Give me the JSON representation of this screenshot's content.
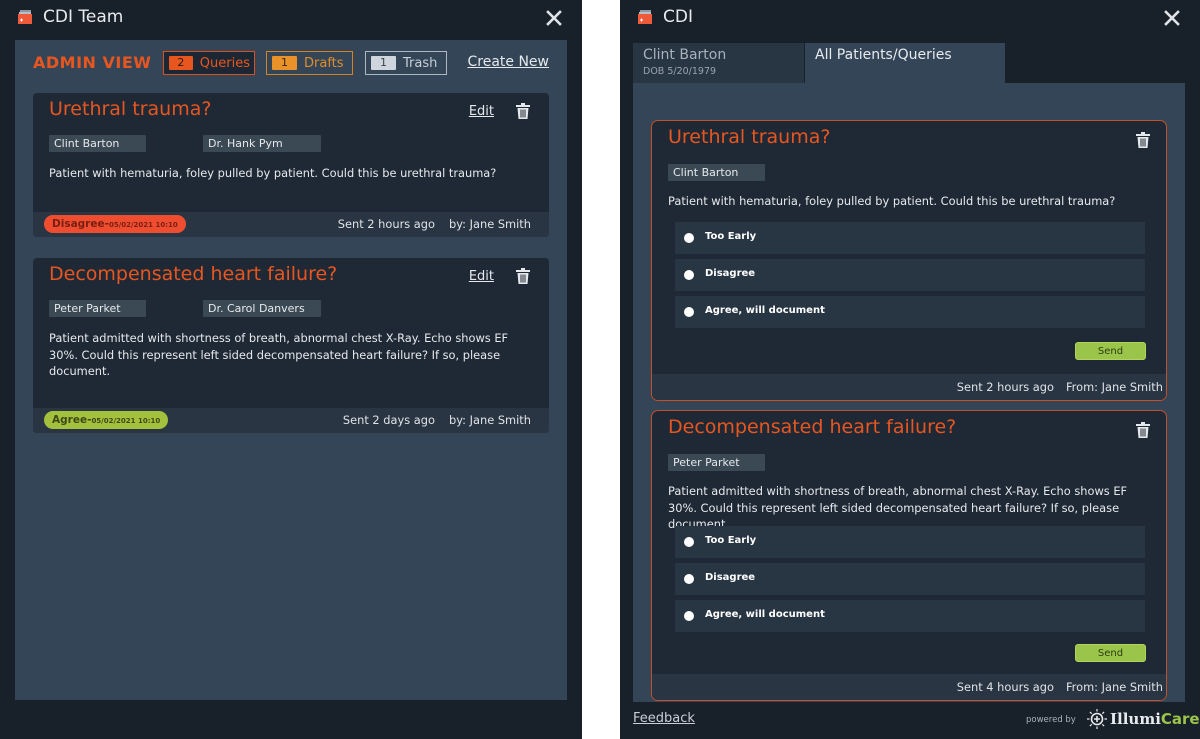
{
  "left_window": {
    "title": "CDI Team",
    "admin_title": "ADMIN VIEW",
    "filters": [
      {
        "count": "2",
        "label": "Queries",
        "color": "#e8561f"
      },
      {
        "count": "1",
        "label": "Drafts",
        "color": "#e9922a"
      },
      {
        "count": "1",
        "label": "Trash",
        "color": "#cfd5dc"
      }
    ],
    "create_new_label": "Create New",
    "queries": [
      {
        "title": "Urethral trauma?",
        "edit_label": "Edit",
        "patient": "Clint Barton",
        "doctor": "Dr. Hank Pym",
        "body": "Patient with hematuria, foley pulled by patient. Could this be urethral trauma?",
        "status": "Disagree",
        "status_separator": "-",
        "status_date": "05/02/2021 10:10",
        "status_color": "#ee4e2f",
        "sent": "Sent 2 hours ago",
        "by": "by: Jane Smith"
      },
      {
        "title": "Decompensated heart failure?",
        "edit_label": "Edit",
        "patient": "Peter Parket",
        "doctor": "Dr. Carol Danvers",
        "body": "Patient admitted with shortness of breath, abnormal chest X-Ray. Echo shows EF 30%. Could this represent left sided decompensated heart failure? If so, please document.",
        "status": "Agree",
        "status_separator": "-",
        "status_date": "05/02/2021 10:10",
        "status_color": "#a4c13e",
        "sent": "Sent 2 days ago",
        "by": "by: Jane Smith"
      }
    ]
  },
  "right_window": {
    "title": "CDI",
    "tabs": [
      {
        "label": "Clint Barton",
        "sub": "DOB 5/20/1979",
        "active": false
      },
      {
        "label": "All Patients/Queries",
        "active": true
      }
    ],
    "queries": [
      {
        "title": "Urethral trauma?",
        "patient": "Clint Barton",
        "body": "Patient with hematuria, foley pulled by patient. Could this be urethral trauma?",
        "options": [
          "Too Early",
          "Disagree",
          "Agree, will document"
        ],
        "send_label": "Send",
        "sent": "Sent 2 hours ago",
        "from": "From: Jane Smith"
      },
      {
        "title": "Decompensated heart failure?",
        "patient": "Peter Parket",
        "body": "Patient admitted with shortness of breath, abnormal chest X-Ray. Echo shows EF 30%. Could this represent left sided decompensated heart failure? If so, please document.",
        "options": [
          "Too Early",
          "Disagree",
          "Agree, will document"
        ],
        "send_label": "Send",
        "sent": "Sent 4 hours ago",
        "from": "From: Jane Smith"
      }
    ],
    "footer": {
      "feedback_label": "Feedback",
      "powered_by": "powered by",
      "brand_part1": "Illumi",
      "brand_part2": "Care"
    }
  },
  "colors": {
    "accent_orange": "#e8561f",
    "accent_green": "#9bc44a",
    "window_bg": "#18202a",
    "panel_bg": "#344557",
    "card_bg": "#1f2936"
  }
}
